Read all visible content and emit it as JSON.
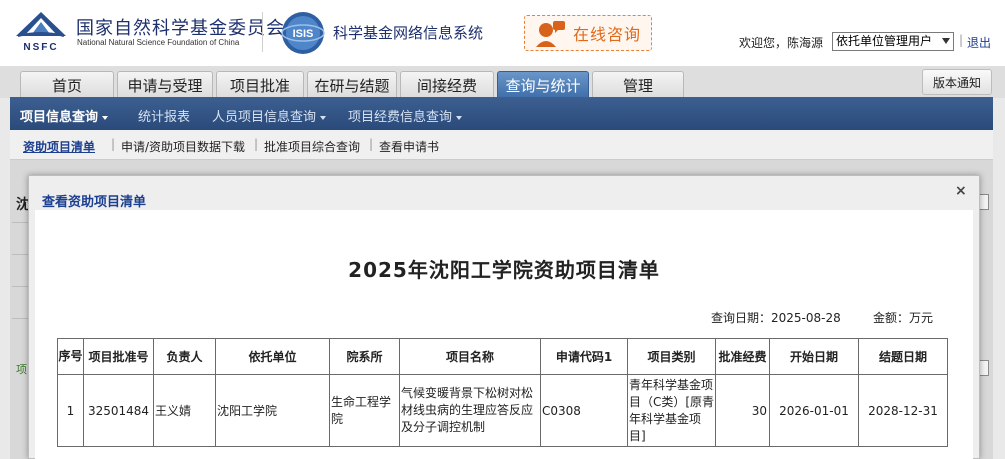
{
  "header": {
    "org_name_cn": "国家自然科学基金委员会",
    "org_name_en": "National Natural Science Foundation of China",
    "nsfc_logo_text": "NSFC",
    "isis_logo_text": "ISIS",
    "system_title": "科学基金网络信息系统",
    "consult_label": "在线咨询",
    "welcome": "欢迎您，陈海源",
    "role_select_value": "依托单位管理用户",
    "separator": "|",
    "logout": "退出"
  },
  "tabs": [
    {
      "label": "首页",
      "active": false
    },
    {
      "label": "申请与受理",
      "active": false
    },
    {
      "label": "项目批准",
      "active": false
    },
    {
      "label": "在研与结题",
      "active": false
    },
    {
      "label": "间接经费",
      "active": false
    },
    {
      "label": "查询与统计",
      "active": true
    },
    {
      "label": "管理",
      "active": false
    }
  ],
  "notice_button": "版本通知",
  "subnav": {
    "items": [
      "项目信息查询",
      "统计报表",
      "人员项目信息查询",
      "项目经费信息查询"
    ]
  },
  "sublinks": {
    "items": [
      "资助项目清单",
      "申请/资助项目数据下载",
      "批准项目综合查询",
      "查看申请书"
    ],
    "separator": "|"
  },
  "background": {
    "fragment_1": "沈",
    "fragment_2": "项"
  },
  "modal": {
    "title": "查看资助项目清单",
    "close": "×",
    "report_title": "2025年沈阳工学院资助项目清单",
    "query_date": "查询日期：2025-08-28",
    "amount_unit": "金额：万元",
    "table": {
      "headers": [
        "序号",
        "项目批准号",
        "负责人",
        "依托单位",
        "院系所",
        "项目名称",
        "申请代码1",
        "项目类别",
        "批准经费",
        "开始日期",
        "结题日期"
      ],
      "rows": [
        [
          "1",
          "32501484",
          "王义婧",
          "沈阳工学院",
          "生命工程学院",
          "气候变暖背景下松树对松材线虫病的生理应答反应及分子调控机制",
          "C0308",
          "青年科学基金项目（C类）[原青年科学基金项目]",
          "30",
          "2026-01-01",
          "2028-12-31"
        ]
      ]
    }
  },
  "colors": {
    "brand_blue": "#1d2f6d",
    "nav_blue": "#2a4a7a",
    "active_tab": "#3f6ea9",
    "consult_orange": "#e06a1a",
    "link_blue": "#1d3f8f"
  }
}
